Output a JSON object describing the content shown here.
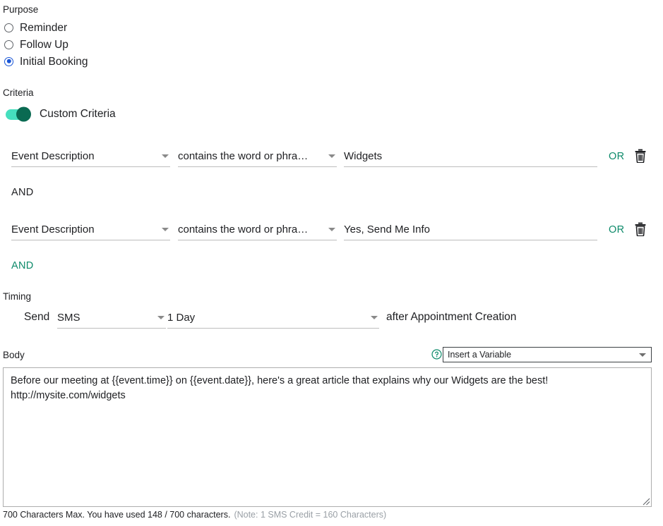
{
  "purpose": {
    "label": "Purpose",
    "options": [
      {
        "label": "Reminder",
        "selected": false
      },
      {
        "label": "Follow Up",
        "selected": false
      },
      {
        "label": "Initial Booking",
        "selected": true
      }
    ]
  },
  "criteria": {
    "label": "Criteria",
    "toggle_label": "Custom Criteria",
    "toggle_on": true,
    "rows": [
      {
        "field": "Event Description",
        "operator": "contains the word or phra…",
        "value": "Widgets",
        "or_label": "OR",
        "delete_icon": "trash-icon"
      },
      {
        "field": "Event Description",
        "operator": "contains the word or phra…",
        "value": "Yes, Send Me Info",
        "or_label": "OR",
        "delete_icon": "trash-icon"
      }
    ],
    "and_between": "AND",
    "and_add": "AND"
  },
  "timing": {
    "label": "Timing",
    "send_label": "Send",
    "channel": "SMS",
    "delay": "1 Day",
    "trigger_label": "after Appointment Creation"
  },
  "body": {
    "label": "Body",
    "help_icon": "help-circle-icon",
    "variable_select": "Insert a Variable",
    "text": "Before our meeting at {{event.time}} on {{event.date}}, here's a great article that explains why our Widgets are the best!\nhttp://mysite.com/widgets",
    "footer_main": "700 Characters Max. You have used 148 / 700 characters.",
    "footer_note": "(Note: 1 SMS Credit = 160 Characters)"
  },
  "colors": {
    "accent_teal": "#0d8a6a",
    "toggle_track": "#45dfbe",
    "toggle_thumb": "#0a6a52",
    "radio_blue": "#1a56d6",
    "underline": "#bdbdbd"
  }
}
